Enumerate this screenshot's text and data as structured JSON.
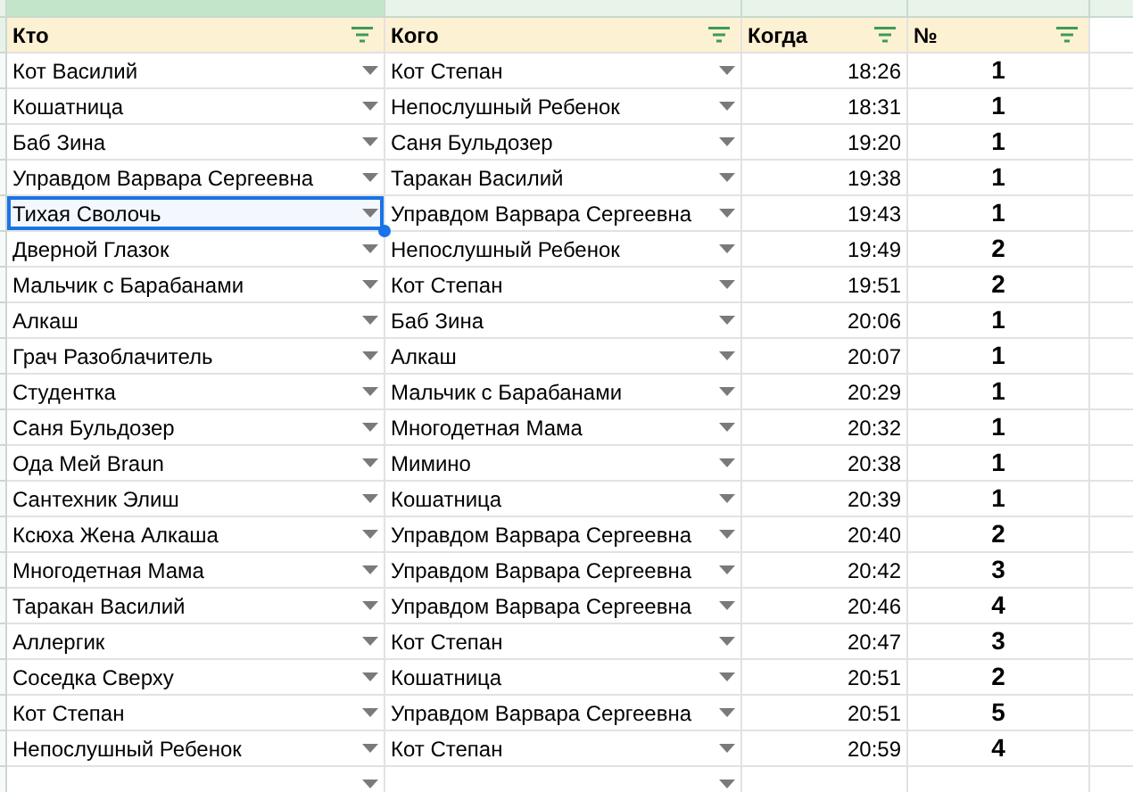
{
  "headers": [
    "Кто",
    "Кого",
    "Когда",
    "№"
  ],
  "rows": [
    {
      "who": "Кот Василий",
      "whom": "Кот Степан",
      "when": "18:26",
      "count": "1",
      "selected": false
    },
    {
      "who": "Кошатница",
      "whom": "Непослушный Ребенок",
      "when": "18:31",
      "count": "1",
      "selected": false
    },
    {
      "who": "Баб Зина",
      "whom": "Саня Бульдозер",
      "when": "19:20",
      "count": "1",
      "selected": false
    },
    {
      "who": "Управдом Варвара Сергеевна",
      "whom": "Таракан Василий",
      "when": "19:38",
      "count": "1",
      "selected": false
    },
    {
      "who": "Тихая Сволочь",
      "whom": "Управдом Варвара Сергеевна",
      "when": "19:43",
      "count": "1",
      "selected": true
    },
    {
      "who": "Дверной Глазок",
      "whom": "Непослушный Ребенок",
      "when": "19:49",
      "count": "2",
      "selected": false
    },
    {
      "who": "Мальчик с Барабанами",
      "whom": "Кот Степан",
      "when": "19:51",
      "count": "2",
      "selected": false
    },
    {
      "who": "Алкаш",
      "whom": "Баб Зина",
      "when": "20:06",
      "count": "1",
      "selected": false
    },
    {
      "who": "Грач Разоблачитель",
      "whom": "Алкаш",
      "when": "20:07",
      "count": "1",
      "selected": false
    },
    {
      "who": "Студентка",
      "whom": "Мальчик с Барабанами",
      "when": "20:29",
      "count": "1",
      "selected": false
    },
    {
      "who": "Саня Бульдозер",
      "whom": "Многодетная Мама",
      "when": "20:32",
      "count": "1",
      "selected": false
    },
    {
      "who": "Ода Мей Braun",
      "whom": "Мимино",
      "when": "20:38",
      "count": "1",
      "selected": false
    },
    {
      "who": "Сантехник Элиш",
      "whom": "Кошатница",
      "when": "20:39",
      "count": "1",
      "selected": false
    },
    {
      "who": "Ксюха Жена Алкаша",
      "whom": "Управдом Варвара Сергеевна",
      "when": "20:40",
      "count": "2",
      "selected": false
    },
    {
      "who": "Многодетная Мама",
      "whom": "Управдом Варвара Сергеевна",
      "when": "20:42",
      "count": "3",
      "selected": false
    },
    {
      "who": "Таракан Василий",
      "whom": "Управдом Варвара Сергеевна",
      "when": "20:46",
      "count": "4",
      "selected": false
    },
    {
      "who": "Аллергик",
      "whom": "Кот Степан",
      "when": "20:47",
      "count": "3",
      "selected": false
    },
    {
      "who": "Соседка Сверху",
      "whom": "Кошатница",
      "when": "20:51",
      "count": "2",
      "selected": false
    },
    {
      "who": "Кот Степан",
      "whom": "Управдом Варвара Сергеевна",
      "when": "20:51",
      "count": "5",
      "selected": false
    },
    {
      "who": "Непослушный Ребенок",
      "whom": "Кот Степан",
      "when": "20:59",
      "count": "4",
      "selected": false
    }
  ]
}
